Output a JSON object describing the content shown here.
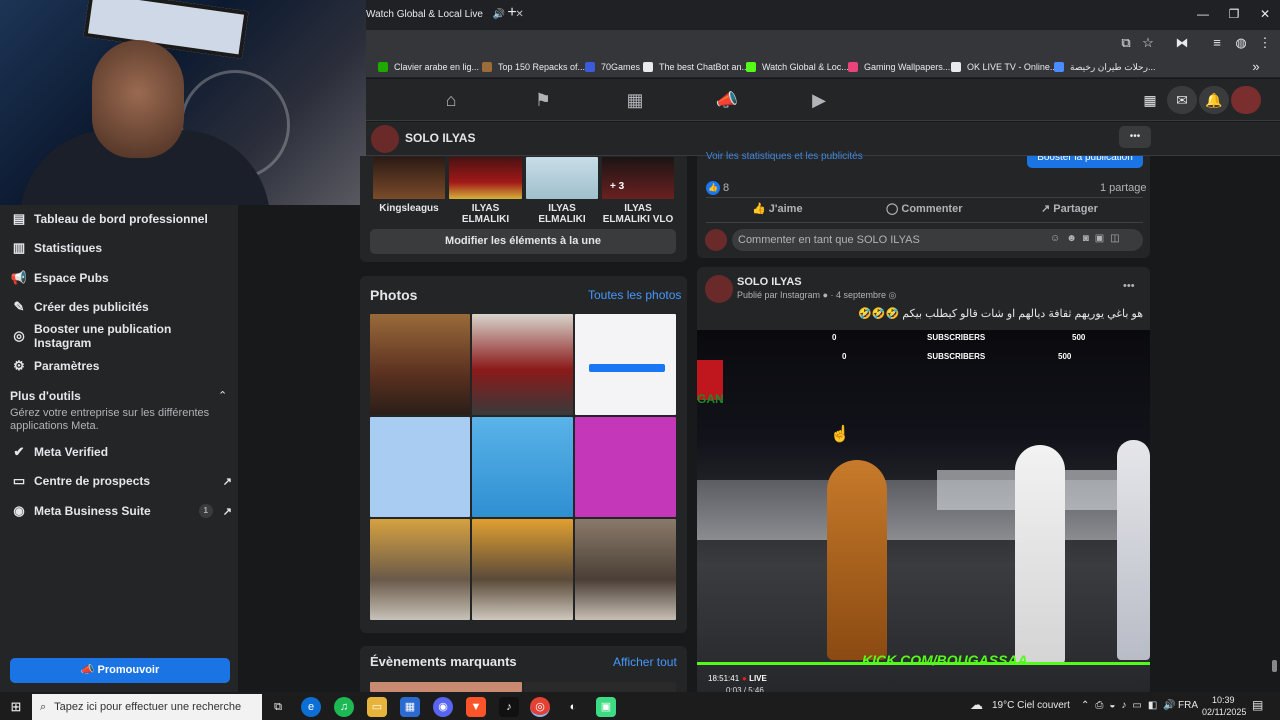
{
  "browser": {
    "tab_title": "Watch Global & Local Live",
    "bookmarks": [
      {
        "label": "Clavier arabe en lig...",
        "color": "#1faa00"
      },
      {
        "label": "Top 150 Repacks of...",
        "color": "#9b6b3a"
      },
      {
        "label": "70Games",
        "color": "#3b5bdb"
      },
      {
        "label": "The best ChatBot an...",
        "color": "#e8eaed"
      },
      {
        "label": "Watch Global & Loc...",
        "color": "#53fc18"
      },
      {
        "label": "Gaming Wallpapers...",
        "color": "#e8447a"
      },
      {
        "label": "OK LIVE TV - Online...",
        "color": "#e8eaed"
      },
      {
        "label": "رحلات طيران رخيصة...",
        "color": "#4a8cff"
      }
    ]
  },
  "page": {
    "name": "SOLO ILYAS",
    "more": "•••"
  },
  "sidebar": {
    "items": [
      {
        "label": "Tableau de bord professionnel",
        "icon": "dashboard-icon"
      },
      {
        "label": "Statistiques",
        "icon": "chart-icon"
      },
      {
        "label": "Espace Pubs",
        "icon": "megaphone-icon"
      },
      {
        "label": "Créer des publicités",
        "icon": "pen-icon"
      },
      {
        "label": "Booster une publication Instagram",
        "icon": "instagram-icon"
      },
      {
        "label": "Paramètres",
        "icon": "gear-icon"
      }
    ],
    "tools_title": "Plus d'outils",
    "tools_desc": "Gérez votre entreprise sur les différentes applications Meta.",
    "tools": [
      {
        "label": "Meta Verified",
        "icon": "verified-icon"
      },
      {
        "label": "Centre de prospects",
        "icon": "leads-icon"
      },
      {
        "label": "Meta Business Suite",
        "icon": "business-icon",
        "badge": "1"
      }
    ],
    "promote": "Promouvoir"
  },
  "featured": {
    "items": [
      {
        "label": "Kingsleagus"
      },
      {
        "label": "ILYAS ELMALIKI"
      },
      {
        "label": "ILYAS ELMALIKI"
      },
      {
        "label": "ILYAS ELMALIKI VLO",
        "overlay": "+ 3"
      }
    ],
    "edit_button": "Modifier les éléments à la une"
  },
  "photos": {
    "title": "Photos",
    "see_all": "Toutes les photos"
  },
  "events": {
    "title": "Évènements marquants",
    "see_all": "Afficher tout"
  },
  "post1": {
    "cut_link": "Voir les statistiques et les publicités",
    "boost": "Booster la publication",
    "reactions": "8",
    "shares": "1 partage",
    "like": "J'aime",
    "comment": "Commenter",
    "share": "Partager",
    "comment_placeholder": "Commenter en tant que SOLO ILYAS"
  },
  "post2": {
    "author": "SOLO ILYAS",
    "meta": "Publié par Instagram",
    "date": "4 septembre",
    "text": "هو باغي يوريهم ثقافة ديالهم او شات قالو كيطلب بيكم 🤣🤣🤣",
    "video_overlay": {
      "sub_a_left": "0",
      "sub_a_label": "SUBSCRIBERS",
      "sub_a_right": "500",
      "sub_b_left": "0",
      "sub_b_label": "SUBSCRIBERS",
      "sub_b_right": "500",
      "watermark": "KICK.COM/BOUGASSAA",
      "brand": "GAN",
      "time": "18:51:41",
      "live": "LIVE",
      "progress": "0:03 / 5:46"
    }
  },
  "taskbar": {
    "search_placeholder": "Tapez ici pour effectuer une recherche",
    "weather": "19°C  Ciel couvert",
    "lang": "FRA",
    "time": "10:39",
    "date": "02/11/2025"
  }
}
